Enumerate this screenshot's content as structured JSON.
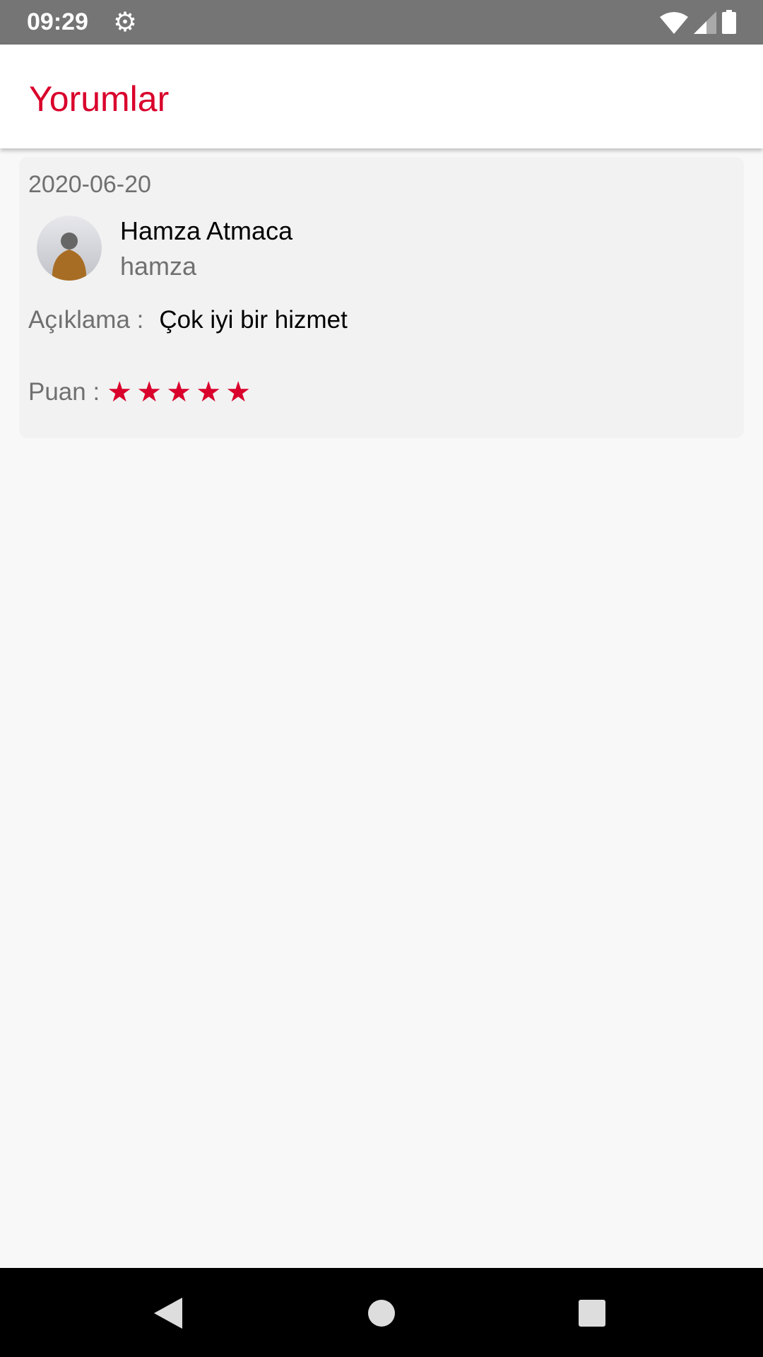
{
  "status_bar": {
    "time": "09:29"
  },
  "app_bar": {
    "title": "Yorumlar",
    "accent_color": "#d9002b"
  },
  "reviews": [
    {
      "date": "2020-06-20",
      "name": "Hamza Atmaca",
      "username": "hamza",
      "description_label": "Açıklama :",
      "description": "Çok iyi bir hizmet",
      "rating_label": "Puan :",
      "rating": 5,
      "rating_max": 5
    }
  ]
}
